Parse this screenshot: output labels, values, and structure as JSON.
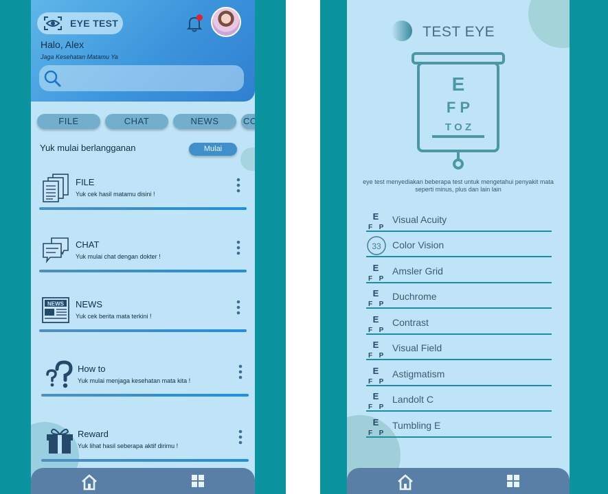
{
  "left_screen": {
    "logo_label": "EYE TEST",
    "greeting": "Halo, Alex",
    "subtitle": "Jaga Kesehatan Matamu Ya",
    "tabs": [
      "FILE",
      "CHAT",
      "NEWS",
      "CO"
    ],
    "subscribe_text": "Yuk mulai berlangganan",
    "subscribe_button": "Mulai",
    "cards": [
      {
        "title": "FILE",
        "desc": "Yuk cek hasil matamu disini !",
        "icon": "documents-icon"
      },
      {
        "title": "CHAT",
        "desc": "Yuk mulai chat dengan dokter !",
        "icon": "chat-bubbles-icon"
      },
      {
        "title": "NEWS",
        "desc": "Yuk cek berita mata terkini !",
        "icon": "newspaper-icon",
        "icon_text": "NEWS"
      },
      {
        "title": "How to",
        "desc": "Yuk mulai menjaga kesehatan mata kita !",
        "icon": "question-marks-icon"
      },
      {
        "title": "Reward",
        "desc": "Yuk lihat hasil seberapa aktif dirimu !",
        "icon": "gift-icon"
      }
    ],
    "nav": {
      "home": "home-icon",
      "grid": "grid-icon"
    }
  },
  "right_screen": {
    "title": "TEST EYE",
    "eye_chart": {
      "row1": "E",
      "row2": "F P",
      "row3": "T O Z"
    },
    "description": "eye test menyediakan beberapa test untuk mengetahui penyakit mata seperti minus, plus dan lain lain",
    "icon_letters": {
      "top": "E",
      "left": "F",
      "right": "P"
    },
    "color_vision_number": "33",
    "tests": [
      {
        "label": "Visual Acuity",
        "icon": "efp"
      },
      {
        "label": "Color Vision",
        "icon": "ishihara"
      },
      {
        "label": "Amsler Grid",
        "icon": "efp"
      },
      {
        "label": "Duchrome",
        "icon": "efp"
      },
      {
        "label": "Contrast",
        "icon": "efp"
      },
      {
        "label": "Visual Field",
        "icon": "efp"
      },
      {
        "label": "Astigmatism",
        "icon": "efp"
      },
      {
        "label": "Landolt C",
        "icon": "efp"
      },
      {
        "label": "Tumbling E",
        "icon": "efp"
      }
    ]
  },
  "colors": {
    "background": "#0b93a0",
    "screen_bg": "#bfe3f7",
    "header_blue": "#3c95dc",
    "nav_bar": "#5a7fa6",
    "accent_line": "#1a8ea3",
    "notification": "#e8202a"
  }
}
